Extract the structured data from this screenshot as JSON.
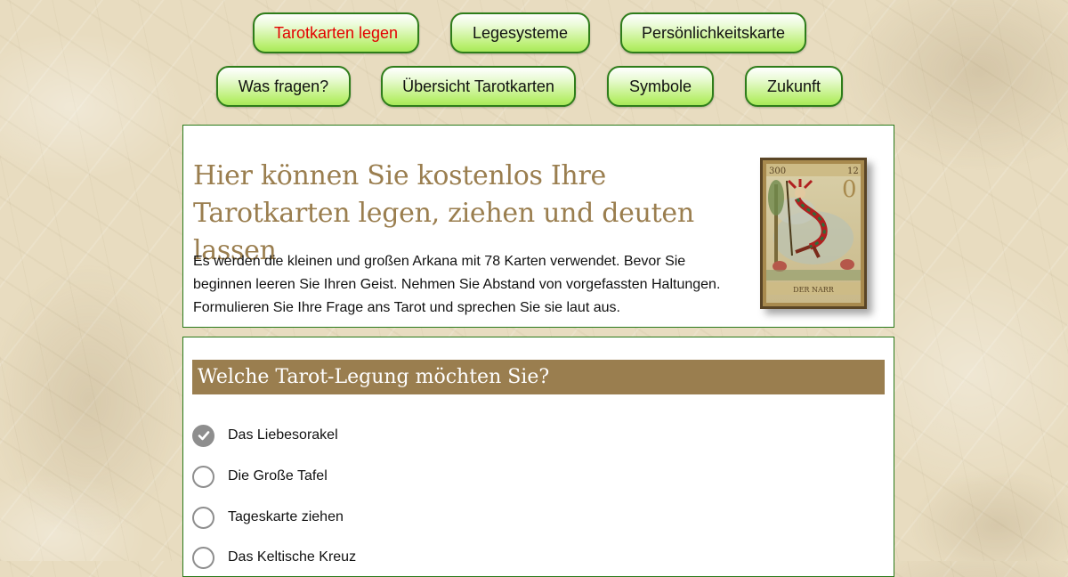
{
  "nav": {
    "items": [
      {
        "label": "Tarotkarten legen",
        "active": true
      },
      {
        "label": "Legesysteme",
        "active": false
      },
      {
        "label": "Persönlichkeitskarte",
        "active": false
      },
      {
        "label": "Was fragen?",
        "active": false
      },
      {
        "label": "Übersicht Tarotkarten",
        "active": false
      },
      {
        "label": "Symbole",
        "active": false
      },
      {
        "label": "Zukunft",
        "active": false
      }
    ]
  },
  "intro": {
    "headline": "Hier können Sie kostenlos Ihre Tarotkarten legen, ziehen und deuten lassen",
    "text": "Es werden die kleinen und großen Arkana mit 78 Karten verwendet. Bevor Sie beginnen leeren Sie Ihren Geist. Nehmen Sie Abstand von vorgefassten Haltungen. Formulieren Sie Ihre Frage ans Tarot und sprechen Sie sie laut aus.",
    "card": {
      "name": "DER NARR",
      "number": "0"
    }
  },
  "spread": {
    "heading": "Welche Tarot-Legung möchten Sie?",
    "selected_index": 0,
    "options": [
      "Das Liebesorakel",
      "Die Große Tafel",
      "Tageskarte ziehen",
      "Das Keltische Kreuz"
    ]
  },
  "colors": {
    "accent_brown": "#9a7e4f",
    "nav_border_green": "#2e7d1a",
    "nav_fill_green": "#b8ef6e",
    "active_nav_text": "#e30000",
    "panel_border": "#2a7a1a"
  }
}
